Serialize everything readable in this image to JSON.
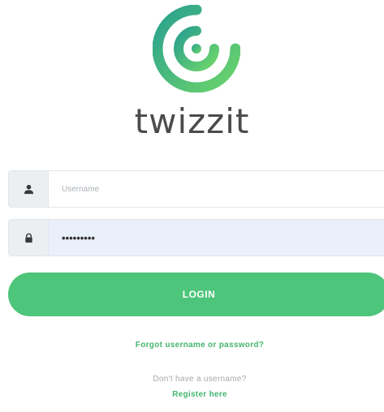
{
  "brand": {
    "name": "twizzit",
    "logo_icon": "spiral-logo-icon",
    "accent_color": "#4dc57a",
    "logo_gradient": [
      "#2fa88e",
      "#67d36c"
    ]
  },
  "form": {
    "username": {
      "icon": "user-icon",
      "placeholder": "Username",
      "value": ""
    },
    "password": {
      "icon": "lock-icon",
      "value": "•••••••••"
    },
    "login_label": "LOGIN"
  },
  "links": {
    "forgot": "Forgot username or password?",
    "no_username": "Don't have a username?",
    "register": "Register here"
  }
}
